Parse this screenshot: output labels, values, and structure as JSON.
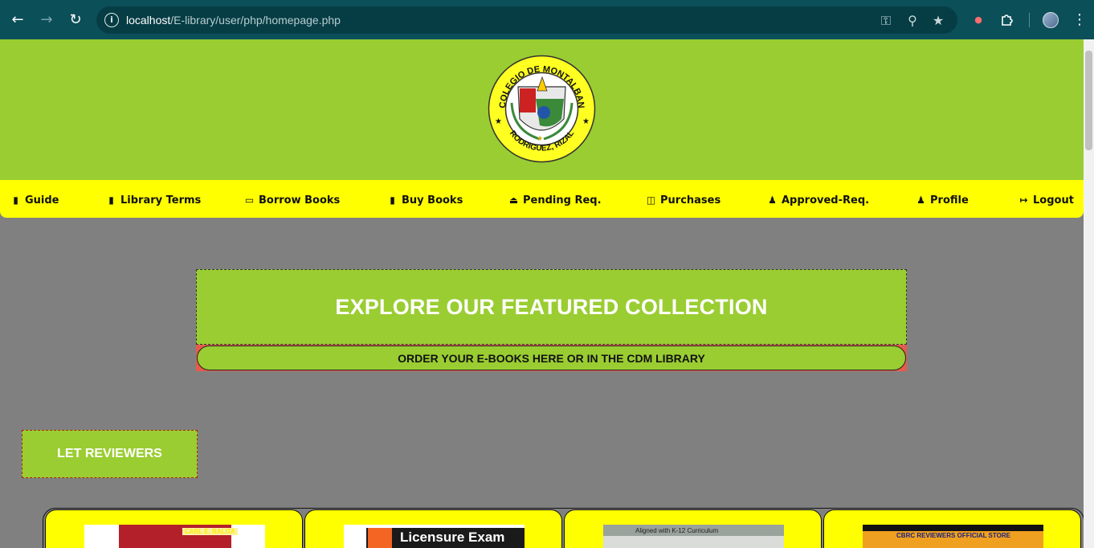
{
  "browser": {
    "url_host": "localhost",
    "url_path": "/E-library/user/php/homepage.php",
    "icons": [
      "back-icon",
      "forward-icon",
      "reload-icon",
      "site-info-icon",
      "password-key-icon",
      "zoom-icon",
      "bookmark-star-icon",
      "extension-icon",
      "puzzle-icon",
      "profile-avatar",
      "menu-kebab-icon"
    ]
  },
  "logo": {
    "top_text": "COLEGIO DE MONTALBAN",
    "bottom_text": "RODRIGUEZ, RIZAL"
  },
  "nav": {
    "items": [
      {
        "label": "Guide",
        "icon": "guide-book-icon"
      },
      {
        "label": "Library Terms",
        "icon": "terms-book-icon"
      },
      {
        "label": "Borrow Books",
        "icon": "open-book-icon"
      },
      {
        "label": "Buy Books",
        "icon": "buy-book-icon"
      },
      {
        "label": "Pending Req.",
        "icon": "pending-eject-icon"
      },
      {
        "label": "Purchases",
        "icon": "basket-icon"
      },
      {
        "label": "Approved-Req.",
        "icon": "person-check-icon"
      },
      {
        "label": "Profile",
        "icon": "user-icon"
      },
      {
        "label": "Logout",
        "icon": "logout-icon"
      }
    ]
  },
  "featured": {
    "title": "EXPLORE OUR FEATURED COLLECTION",
    "subtitle": "ORDER YOUR E-BOOKS HERE OR IN THE CDM LIBRARY"
  },
  "section": {
    "title": "LET REVIEWERS"
  },
  "books": [
    {
      "cover_text": "CARL E. BALITA"
    },
    {
      "cover_text": "Licensure Exam"
    },
    {
      "cover_text": "Aligned with K-12 Curriculum"
    },
    {
      "cover_text": "CBRC REVIEWERS OFFICIAL STORE"
    }
  ],
  "colors": {
    "chrome": "#0b4f59",
    "header": "#9acd32",
    "navbar": "#ffff00",
    "page_bg": "#808080",
    "accent_red": "#e55b4c"
  }
}
